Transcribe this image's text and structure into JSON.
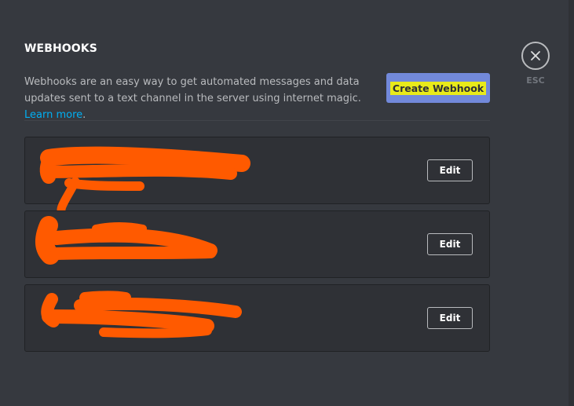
{
  "header": {
    "title": "WEBHOOKS"
  },
  "description": {
    "text": "Webhooks are an easy way to get automated messages and data updates sent to a text channel in the server using internet magic. ",
    "link_label": "Learn more",
    "after_link": "."
  },
  "create_button": {
    "label": "Create Webhook"
  },
  "close": {
    "icon": "close-icon",
    "hint": "ESC"
  },
  "webhooks": [
    {
      "name": "",
      "edit_label": "Edit"
    },
    {
      "name": "",
      "edit_label": "Edit"
    },
    {
      "name": "",
      "edit_label": "Edit"
    }
  ],
  "colors": {
    "background": "#36393f",
    "card": "#2f3136",
    "accent": "#7289da",
    "link": "#00b0f4",
    "redaction": "#ff5a00",
    "highlight": "#e9ea1a"
  }
}
